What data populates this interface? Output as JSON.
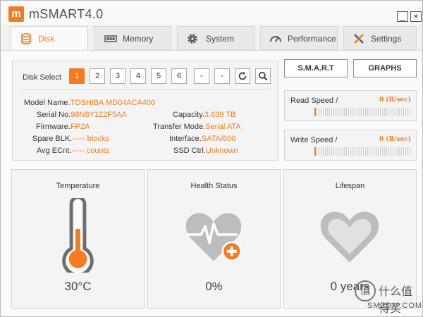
{
  "app": {
    "title": "mSMART4.0",
    "logo_letter": "m",
    "minimize": "_",
    "close": "×"
  },
  "tabs": [
    {
      "label": "Disk",
      "icon": "database-icon",
      "active": true
    },
    {
      "label": "Memory",
      "icon": "memory-icon",
      "active": false
    },
    {
      "label": "System",
      "icon": "gear-icon",
      "active": false
    },
    {
      "label": "Performance",
      "icon": "gauge-icon",
      "active": false
    },
    {
      "label": "Settings",
      "icon": "tools-icon",
      "active": false
    }
  ],
  "disk_select": {
    "label": "Disk Select",
    "buttons": [
      "1",
      "2",
      "3",
      "4",
      "5",
      "6",
      "-",
      "-"
    ],
    "selected": "1"
  },
  "info": {
    "model_label": "Model Name.",
    "model_value": "TOSHIBA MD04ACA400",
    "serial_label": "Serial No.",
    "serial_value": "98N8Y122F5AA",
    "firmware_label": "Firmware.",
    "firmware_value": "FP2A",
    "spare_label": "Spare BLK.",
    "spare_value": "----- blocks",
    "avg_label": "Avg ECnt.",
    "avg_value": "----- counts",
    "capacity_label": "Capacity.",
    "capacity_value": "3.639 TB",
    "transfer_label": "Transfer Mode.",
    "transfer_value": "Serial ATA",
    "interface_label": "Interface.",
    "interface_value": "SATA/600",
    "ssd_label": "SSD Ctrl.",
    "ssd_value": "Unknown"
  },
  "actions": {
    "smart": "S.M.A.R.T",
    "graphs": "GRAPHS"
  },
  "speed": {
    "read_label": "Read Speed /",
    "read_value": "0 (B/sec)",
    "write_label": "Write Speed /",
    "write_value": "0 (B/sec)"
  },
  "stats": {
    "temperature_title": "Temperature",
    "temperature_value": "30°C",
    "health_title": "Health Status",
    "health_value": "0%",
    "lifespan_title": "Lifespan",
    "lifespan_value": "0  years"
  },
  "watermark": {
    "glyph": "值",
    "text": "什么值得买",
    "sub": "SMZDM.COM"
  },
  "colors": {
    "accent": "#f47b20",
    "icon_gray": "#777777"
  }
}
